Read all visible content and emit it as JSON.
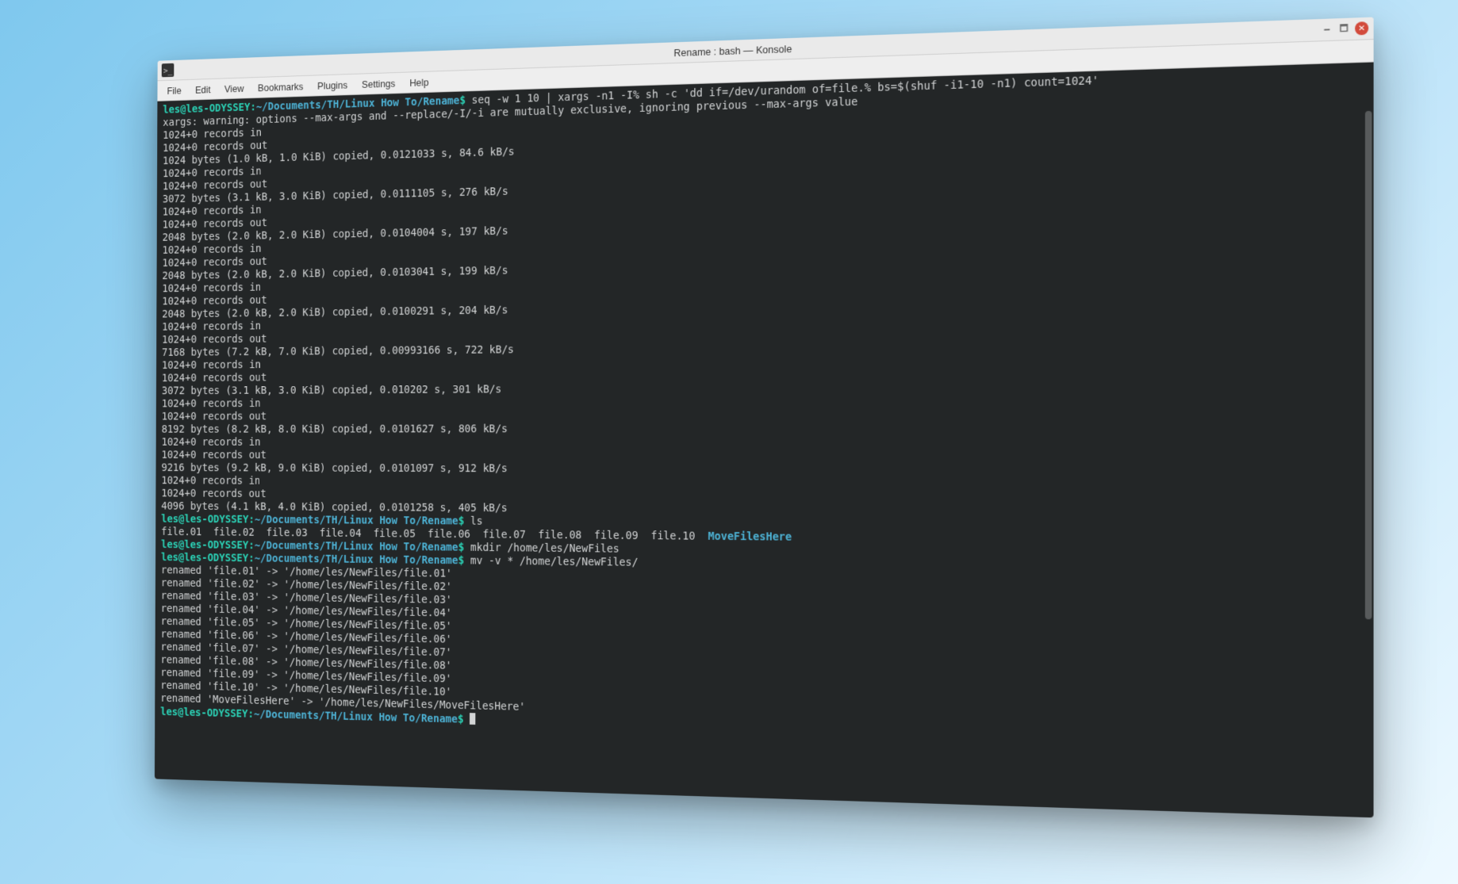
{
  "titlebar": {
    "title": "Rename : bash — Konsole"
  },
  "menubar": {
    "items": [
      "File",
      "Edit",
      "View",
      "Bookmarks",
      "Plugins",
      "Settings",
      "Help"
    ]
  },
  "colors": {
    "prompt": "#2bd1b5",
    "path": "#4db3d6",
    "text": "#d2d4d5",
    "terminal_bg": "#232627"
  },
  "terminal": {
    "prompt_user_host": "les@les-ODYSSEY",
    "prompt_path": "~/Documents/TH/Linux How To/Rename",
    "prompt_end": "$ ",
    "cmd1": "seq -w 1 10 | xargs -n1 -I% sh -c 'dd if=/dev/urandom of=file.% bs=$(shuf -i1-10 -n1) count=1024'",
    "warning_line": "xargs: warning: options --max-args and --replace/-I/-i are mutually exclusive, ignoring previous --max-args value",
    "rec_in": "1024+0 records in",
    "rec_out": "1024+0 records out",
    "dd": [
      "1024 bytes (1.0 kB, 1.0 KiB) copied, 0.0121033 s, 84.6 kB/s",
      "3072 bytes (3.1 kB, 3.0 KiB) copied, 0.0111105 s, 276 kB/s",
      "2048 bytes (2.0 kB, 2.0 KiB) copied, 0.0104004 s, 197 kB/s",
      "2048 bytes (2.0 kB, 2.0 KiB) copied, 0.0103041 s, 199 kB/s",
      "2048 bytes (2.0 kB, 2.0 KiB) copied, 0.0100291 s, 204 kB/s",
      "7168 bytes (7.2 kB, 7.0 KiB) copied, 0.00993166 s, 722 kB/s",
      "3072 bytes (3.1 kB, 3.0 KiB) copied, 0.010202 s, 301 kB/s",
      "8192 bytes (8.2 kB, 8.0 KiB) copied, 0.0101627 s, 806 kB/s",
      "9216 bytes (9.2 kB, 9.0 KiB) copied, 0.0101097 s, 912 kB/s",
      "4096 bytes (4.1 kB, 4.0 KiB) copied, 0.0101258 s, 405 kB/s"
    ],
    "cmd2": "ls",
    "ls_files": "file.01  file.02  file.03  file.04  file.05  file.06  file.07  file.08  file.09  file.10  ",
    "ls_dir": "MoveFilesHere",
    "cmd3": "mkdir /home/les/NewFiles",
    "cmd4": "mv -v * /home/les/NewFiles/",
    "renames": [
      "renamed 'file.01' -> '/home/les/NewFiles/file.01'",
      "renamed 'file.02' -> '/home/les/NewFiles/file.02'",
      "renamed 'file.03' -> '/home/les/NewFiles/file.03'",
      "renamed 'file.04' -> '/home/les/NewFiles/file.04'",
      "renamed 'file.05' -> '/home/les/NewFiles/file.05'",
      "renamed 'file.06' -> '/home/les/NewFiles/file.06'",
      "renamed 'file.07' -> '/home/les/NewFiles/file.07'",
      "renamed 'file.08' -> '/home/les/NewFiles/file.08'",
      "renamed 'file.09' -> '/home/les/NewFiles/file.09'",
      "renamed 'file.10' -> '/home/les/NewFiles/file.10'",
      "renamed 'MoveFilesHere' -> '/home/les/NewFiles/MoveFilesHere'"
    ]
  }
}
